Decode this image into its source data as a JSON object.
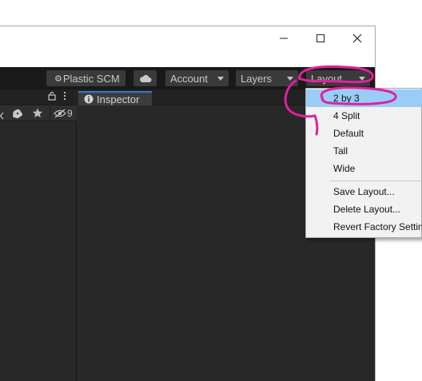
{
  "window": {
    "controls": {
      "minimize": "—",
      "maximize": "☐",
      "close": "✕"
    }
  },
  "toolbar": {
    "plastic_scm_label": "Plastic SCM",
    "account_label": "Account",
    "layers_label": "Layers",
    "layout_label": "Layout"
  },
  "left_panel": {
    "hidden_count": "9"
  },
  "inspector": {
    "tab_label": "Inspector"
  },
  "layout_menu": {
    "items": [
      {
        "label": "2 by 3",
        "highlighted": true
      },
      {
        "label": "4 Split"
      },
      {
        "label": "Default"
      },
      {
        "label": "Tall"
      },
      {
        "label": "Wide"
      },
      {
        "label": "Save Layout..."
      },
      {
        "label": "Delete Layout..."
      },
      {
        "label": "Revert Factory Settings"
      }
    ]
  },
  "colors": {
    "toolbar_bg": "#191919",
    "panel_bg": "#282828",
    "menu_bg": "#f2f2f2",
    "highlight": "#99cdf5",
    "annotation": "#e0219f",
    "tab_accent": "#2d7bd6"
  }
}
